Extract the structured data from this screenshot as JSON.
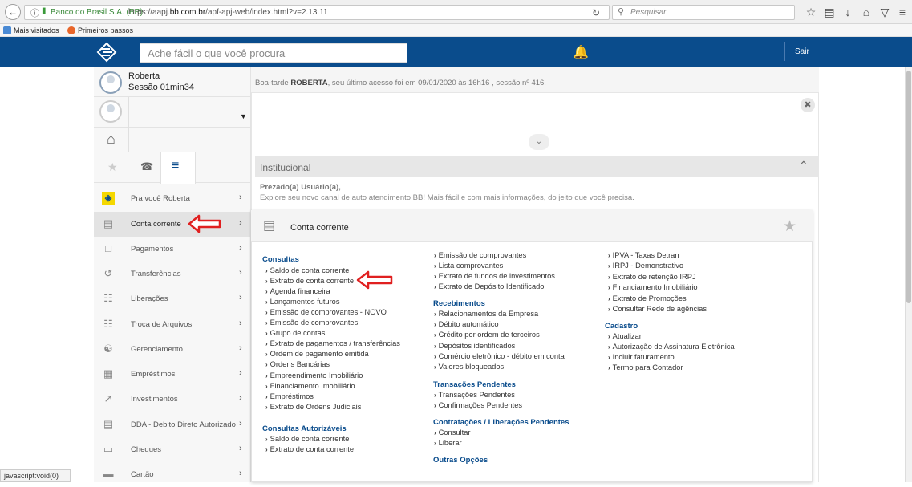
{
  "browser": {
    "site_identity": "Banco do Brasil S.A. (BR)",
    "url_prefix": "https://aapj.",
    "url_domain": "bb.com.br",
    "url_suffix": "/apf-apj-web/index.html?v=2.13.11",
    "search_placeholder": "Pesquisar",
    "bookmarks": [
      "Mais visitados",
      "Primeiros passos"
    ],
    "status_text": "javascript:void(0)"
  },
  "header": {
    "search_placeholder": "Ache fácil o que você procura",
    "logout_label": "Sair",
    "brand_color": "#0a4c8c"
  },
  "user": {
    "name": "Roberta",
    "session": "Sessão 01min34",
    "greeting_pre": "Boa-tarde ",
    "greeting_name": "ROBERTA",
    "greeting_post": ", seu último acesso foi em 09/01/2020 às 16h16 , sessão nº 416."
  },
  "sidebar": {
    "items": [
      {
        "label": "Pra você Roberta",
        "icon": "bb-logo-icon"
      },
      {
        "label": "Conta corrente",
        "icon": "checkbook-icon"
      },
      {
        "label": "Pagamentos",
        "icon": "barcode-icon"
      },
      {
        "label": "Transferências",
        "icon": "transfer-icon"
      },
      {
        "label": "Liberações",
        "icon": "release-icon"
      },
      {
        "label": "Troca de Arquivos",
        "icon": "file-exchange-icon"
      },
      {
        "label": "Gerenciamento",
        "icon": "org-chart-icon"
      },
      {
        "label": "Empréstimos",
        "icon": "loan-icon"
      },
      {
        "label": "Investimentos",
        "icon": "chart-line-icon"
      },
      {
        "label": "DDA - Debito Direto Autorizado",
        "icon": "dda-icon"
      },
      {
        "label": "Cheques",
        "icon": "cheque-icon"
      },
      {
        "label": "Cartão",
        "icon": "card-icon"
      }
    ]
  },
  "institucional": {
    "title": "Institucional",
    "salutation": "Prezado(a) Usuário(a),",
    "text": "Explore seu novo canal de auto atendimento BB! Mais fácil e com mais informações, do jeito que você precisa."
  },
  "conta_corrente": {
    "title": "Conta corrente",
    "col1": {
      "sections": [
        {
          "title": "Consultas",
          "links": [
            "Saldo de conta corrente",
            "Extrato de conta corrente",
            "Agenda financeira",
            "Lançamentos futuros",
            "Emissão de comprovantes - NOVO",
            "Emissão de comprovantes",
            "Grupo de contas",
            "Extrato de pagamentos / transferências",
            "Ordem de pagamento emitida",
            "Ordens Bancárias",
            "Empreendimento Imobiliário",
            "Financiamento Imobiliário",
            "Empréstimos",
            "Extrato de Ordens Judiciais"
          ]
        },
        {
          "title": "Consultas Autorizáveis",
          "links": [
            "Saldo de conta corrente",
            "Extrato de conta corrente"
          ]
        }
      ]
    },
    "col2": {
      "top_links": [
        "Emissão de comprovantes",
        "Lista comprovantes",
        "Extrato de fundos de investimentos",
        "Extrato de Depósito Identificado"
      ],
      "sections": [
        {
          "title": "Recebimentos",
          "links": [
            "Relacionamentos da Empresa",
            "Débito automático",
            "Crédito por ordem de terceiros",
            "Depósitos identificados",
            "Comércio eletrônico - débito em conta",
            "Valores bloqueados"
          ]
        },
        {
          "title": "Transações Pendentes",
          "links": [
            "Transações Pendentes",
            "Confirmações Pendentes"
          ]
        },
        {
          "title": "Contratações / Liberações Pendentes",
          "links": [
            "Consultar",
            "Liberar"
          ]
        },
        {
          "title": "Outras Opções",
          "links": []
        }
      ]
    },
    "col3": {
      "top_links": [
        "IPVA - Taxas Detran",
        "IRPJ - Demonstrativo",
        "Extrato de retenção IRPJ",
        "Financiamento Imobiliário",
        "Extrato de Promoções",
        "Consultar Rede de agências"
      ],
      "sections": [
        {
          "title": "Cadastro",
          "links": [
            "Atualizar",
            "Autorização de Assinatura Eletrônica",
            "Incluir faturamento",
            "Termo para Contador"
          ]
        }
      ]
    }
  }
}
